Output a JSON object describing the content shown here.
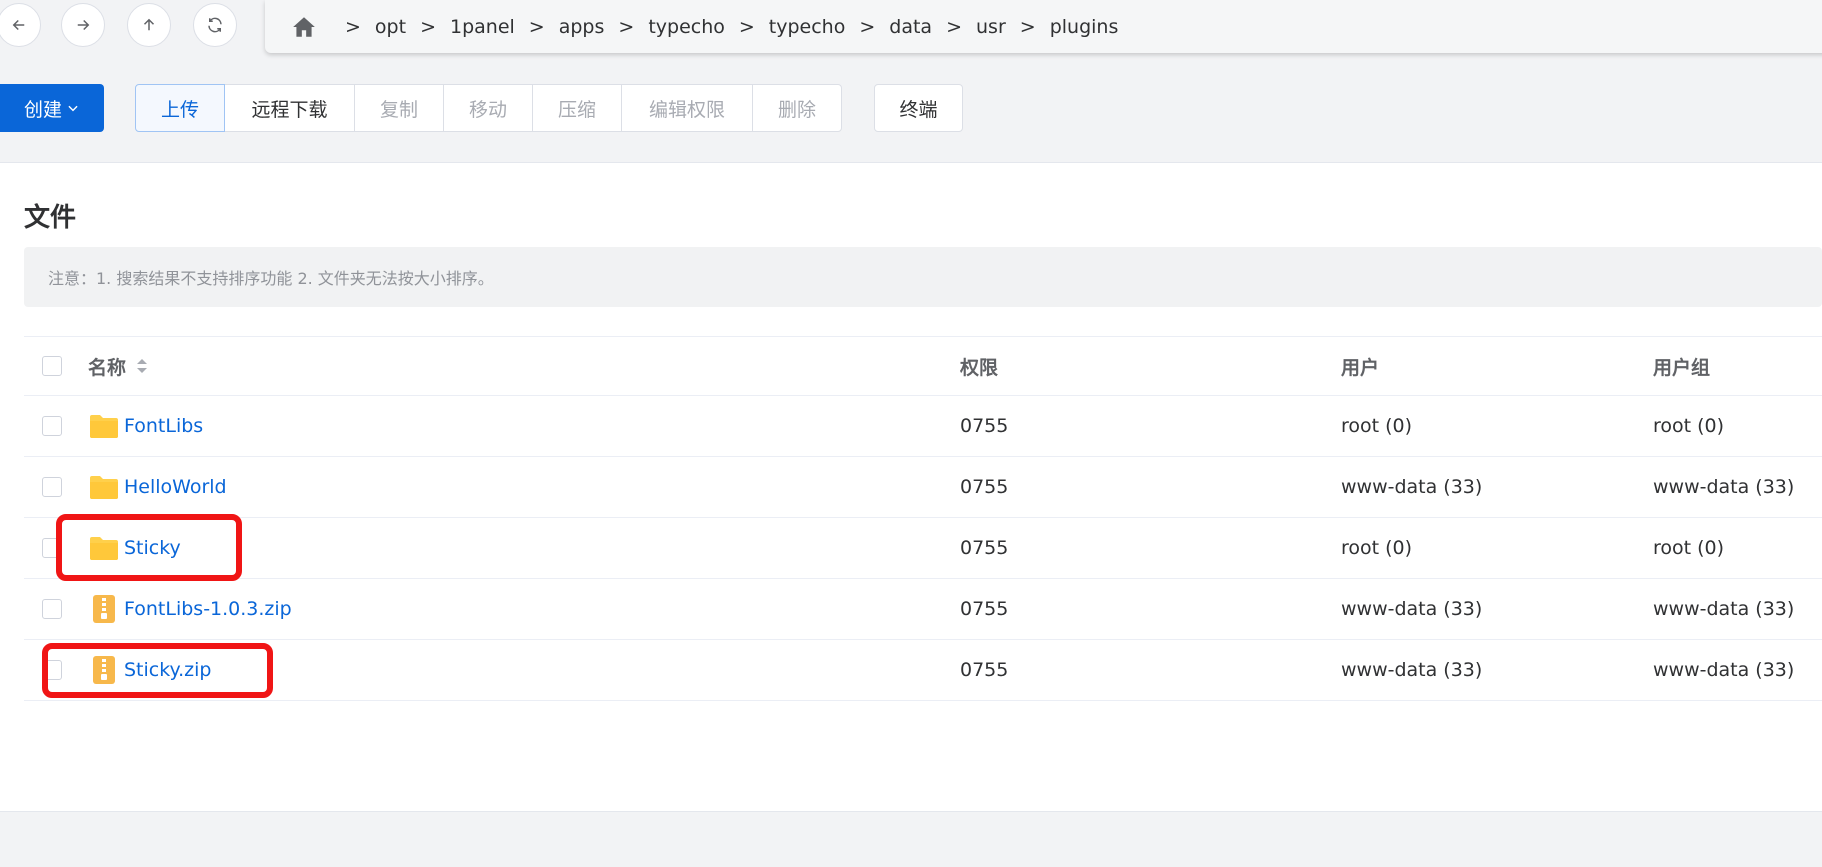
{
  "nav": {
    "path": [
      "opt",
      "1panel",
      "apps",
      "typecho",
      "typecho",
      "data",
      "usr",
      "plugins"
    ],
    "separator": ">"
  },
  "toolbar": {
    "create_label": "创建",
    "upload_label": "上传",
    "remote_download_label": "远程下载",
    "copy_label": "复制",
    "move_label": "移动",
    "compress_label": "压缩",
    "edit_permissions_label": "编辑权限",
    "delete_label": "删除",
    "terminal_label": "终端"
  },
  "card": {
    "title": "文件",
    "notice": "注意：1. 搜索结果不支持排序功能 2. 文件夹无法按大小排序。"
  },
  "table": {
    "columns": [
      "名称",
      "权限",
      "用户",
      "用户组"
    ],
    "rows": [
      {
        "name": "FontLibs",
        "type": "folder",
        "permission": "0755",
        "user": "root (0)",
        "group": "root (0)"
      },
      {
        "name": "HelloWorld",
        "type": "folder",
        "permission": "0755",
        "user": "www-data (33)",
        "group": "www-data (33)"
      },
      {
        "name": "Sticky",
        "type": "folder",
        "permission": "0755",
        "user": "root (0)",
        "group": "root (0)"
      },
      {
        "name": "FontLibs-1.0.3.zip",
        "type": "zip",
        "permission": "0755",
        "user": "www-data (33)",
        "group": "www-data (33)"
      },
      {
        "name": "Sticky.zip",
        "type": "zip",
        "permission": "0755",
        "user": "www-data (33)",
        "group": "www-data (33)"
      }
    ]
  },
  "colors": {
    "accent": "#0a66d8",
    "highlight": "#f01515",
    "folder": "#ffd04b",
    "zip": "#f7b84b"
  }
}
